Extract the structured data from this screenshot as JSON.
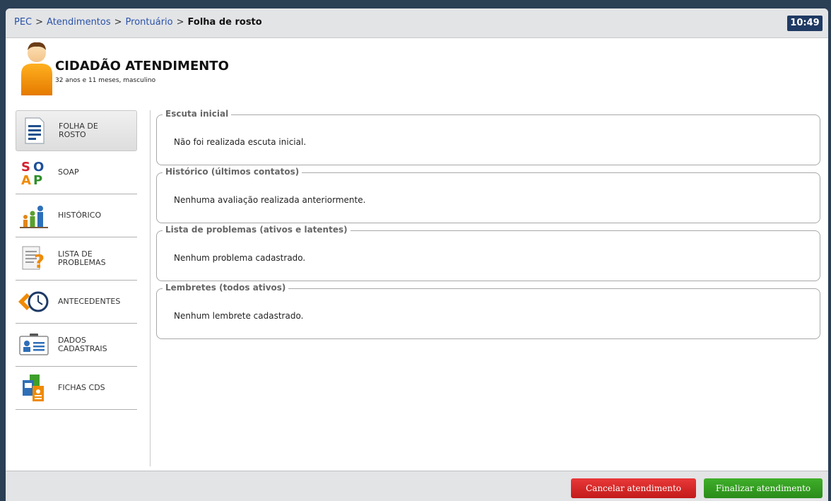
{
  "breadcrumb": {
    "items": [
      "PEC",
      "Atendimentos",
      "Prontuário"
    ],
    "separator": ">",
    "current": "Folha de rosto"
  },
  "clock": "10:49",
  "patient": {
    "name": "CIDADÃO ATENDIMENTO",
    "info": "32 anos e 11 meses, masculino",
    "avatar_icon": "user-avatar-icon"
  },
  "sidebar": {
    "items": [
      {
        "label_line1": "FOLHA DE",
        "label_line2": "ROSTO",
        "icon": "document-lines-icon",
        "active": true
      },
      {
        "label_line1": "SOAP",
        "label_line2": "",
        "icon": "soap-icon",
        "active": false
      },
      {
        "label_line1": "HISTÓRICO",
        "label_line2": "",
        "icon": "people-history-icon",
        "active": false
      },
      {
        "label_line1": "LISTA DE",
        "label_line2": "PROBLEMAS",
        "icon": "problem-list-icon",
        "active": false
      },
      {
        "label_line1": "ANTECEDENTES",
        "label_line2": "",
        "icon": "clock-back-icon",
        "active": false
      },
      {
        "label_line1": "DADOS",
        "label_line2": "CADASTRAIS",
        "icon": "id-card-icon",
        "active": false
      },
      {
        "label_line1": "FICHAS CDS",
        "label_line2": "",
        "icon": "cds-forms-icon",
        "active": false
      }
    ]
  },
  "sections": [
    {
      "title": "Escuta inicial",
      "body": "Não foi realizada escuta inicial."
    },
    {
      "title": "Histórico (últimos contatos)",
      "body": "Nenhuma avaliação realizada anteriormente."
    },
    {
      "title": "Lista de problemas (ativos e latentes)",
      "body": "Nenhum problema cadastrado."
    },
    {
      "title": "Lembretes (todos ativos)",
      "body": "Nenhum lembrete cadastrado."
    }
  ],
  "footer": {
    "cancel_label": "Cancelar atendimento",
    "finish_label": "Finalizar atendimento"
  },
  "colors": {
    "header_bg": "#e3e4e6",
    "clock_bg": "#1f3a63",
    "link": "#2a53a8",
    "cancel": "#d62828",
    "finish": "#34a022"
  }
}
